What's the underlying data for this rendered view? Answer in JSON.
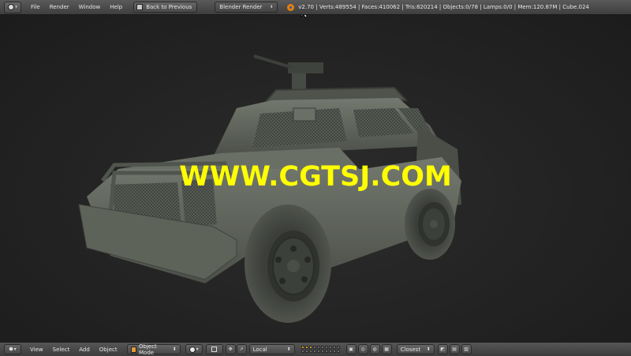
{
  "header": {
    "menus": [
      "File",
      "Render",
      "Window",
      "Help"
    ],
    "back_button": "Back to Previous",
    "render_engine": "Blender Render",
    "stats": "v2.70 | Verts:489554 | Faces:410062 | Tris:820214 | Objects:0/78 | Lamps:0/0 | Mem:120.87M | Cube.024"
  },
  "viewport": {
    "watermark": "WWW.CGTSJ.COM"
  },
  "view3d_header": {
    "menus": [
      "View",
      "Select",
      "Add",
      "Object"
    ],
    "mode": "Object Mode",
    "orientation": "Local",
    "snap_target": "Closest"
  },
  "colors": {
    "watermark": "#ffff00",
    "accent": "#e87d0d",
    "layer_active": "#d99b26"
  },
  "icons": [
    "editor-type-icon",
    "back-icon",
    "blender-logo-icon",
    "object-cube-icon",
    "viewport-shading-icon",
    "pivot-icon",
    "manipulator-icons",
    "layer-grid",
    "proportional-edit-icon",
    "snap-icon",
    "render-icon",
    "camera-icon"
  ]
}
